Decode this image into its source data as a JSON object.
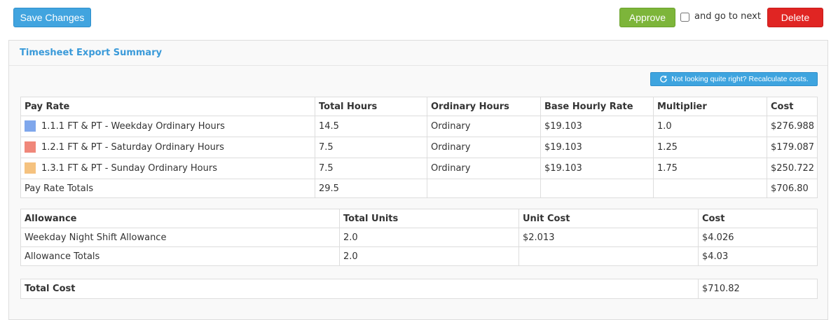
{
  "toolbar": {
    "save_label": "Save Changes",
    "approve_label": "Approve",
    "go_next_label": "and go to next",
    "delete_label": "Delete",
    "colors": {
      "save": "#41a4df",
      "approve": "#7db53a",
      "delete": "#e02523"
    }
  },
  "panel": {
    "title": "Timesheet Export Summary",
    "recalc_label": "Not looking quite right? Recalculate costs.",
    "recalc_icon": "refresh-icon"
  },
  "pay_rates": {
    "headers": [
      "Pay Rate",
      "Total Hours",
      "Ordinary Hours",
      "Base Hourly Rate",
      "Multiplier",
      "Cost"
    ],
    "rows": [
      {
        "color": "#7fa7ec",
        "name": "1.1.1 FT & PT - Weekday Ordinary Hours",
        "total_hours": "14.5",
        "ordinary": "Ordinary",
        "rate": "$19.103",
        "multiplier": "1.0",
        "cost": "$276.988"
      },
      {
        "color": "#f0877a",
        "name": "1.2.1 FT & PT - Saturday Ordinary Hours",
        "total_hours": "7.5",
        "ordinary": "Ordinary",
        "rate": "$19.103",
        "multiplier": "1.25",
        "cost": "$179.087"
      },
      {
        "color": "#f5c27f",
        "name": "1.3.1 FT & PT - Sunday Ordinary Hours",
        "total_hours": "7.5",
        "ordinary": "Ordinary",
        "rate": "$19.103",
        "multiplier": "1.75",
        "cost": "$250.722"
      }
    ],
    "totals": {
      "label": "Pay Rate Totals",
      "total_hours": "29.5",
      "cost": "$706.80"
    }
  },
  "allowances": {
    "headers": [
      "Allowance",
      "Total Units",
      "Unit Cost",
      "Cost"
    ],
    "rows": [
      {
        "name": "Weekday Night Shift Allowance",
        "units": "2.0",
        "unit_cost": "$2.013",
        "cost": "$4.026"
      }
    ],
    "totals": {
      "label": "Allowance Totals",
      "units": "2.0",
      "cost": "$4.03"
    }
  },
  "total_cost": {
    "label": "Total Cost",
    "value": "$710.82"
  }
}
